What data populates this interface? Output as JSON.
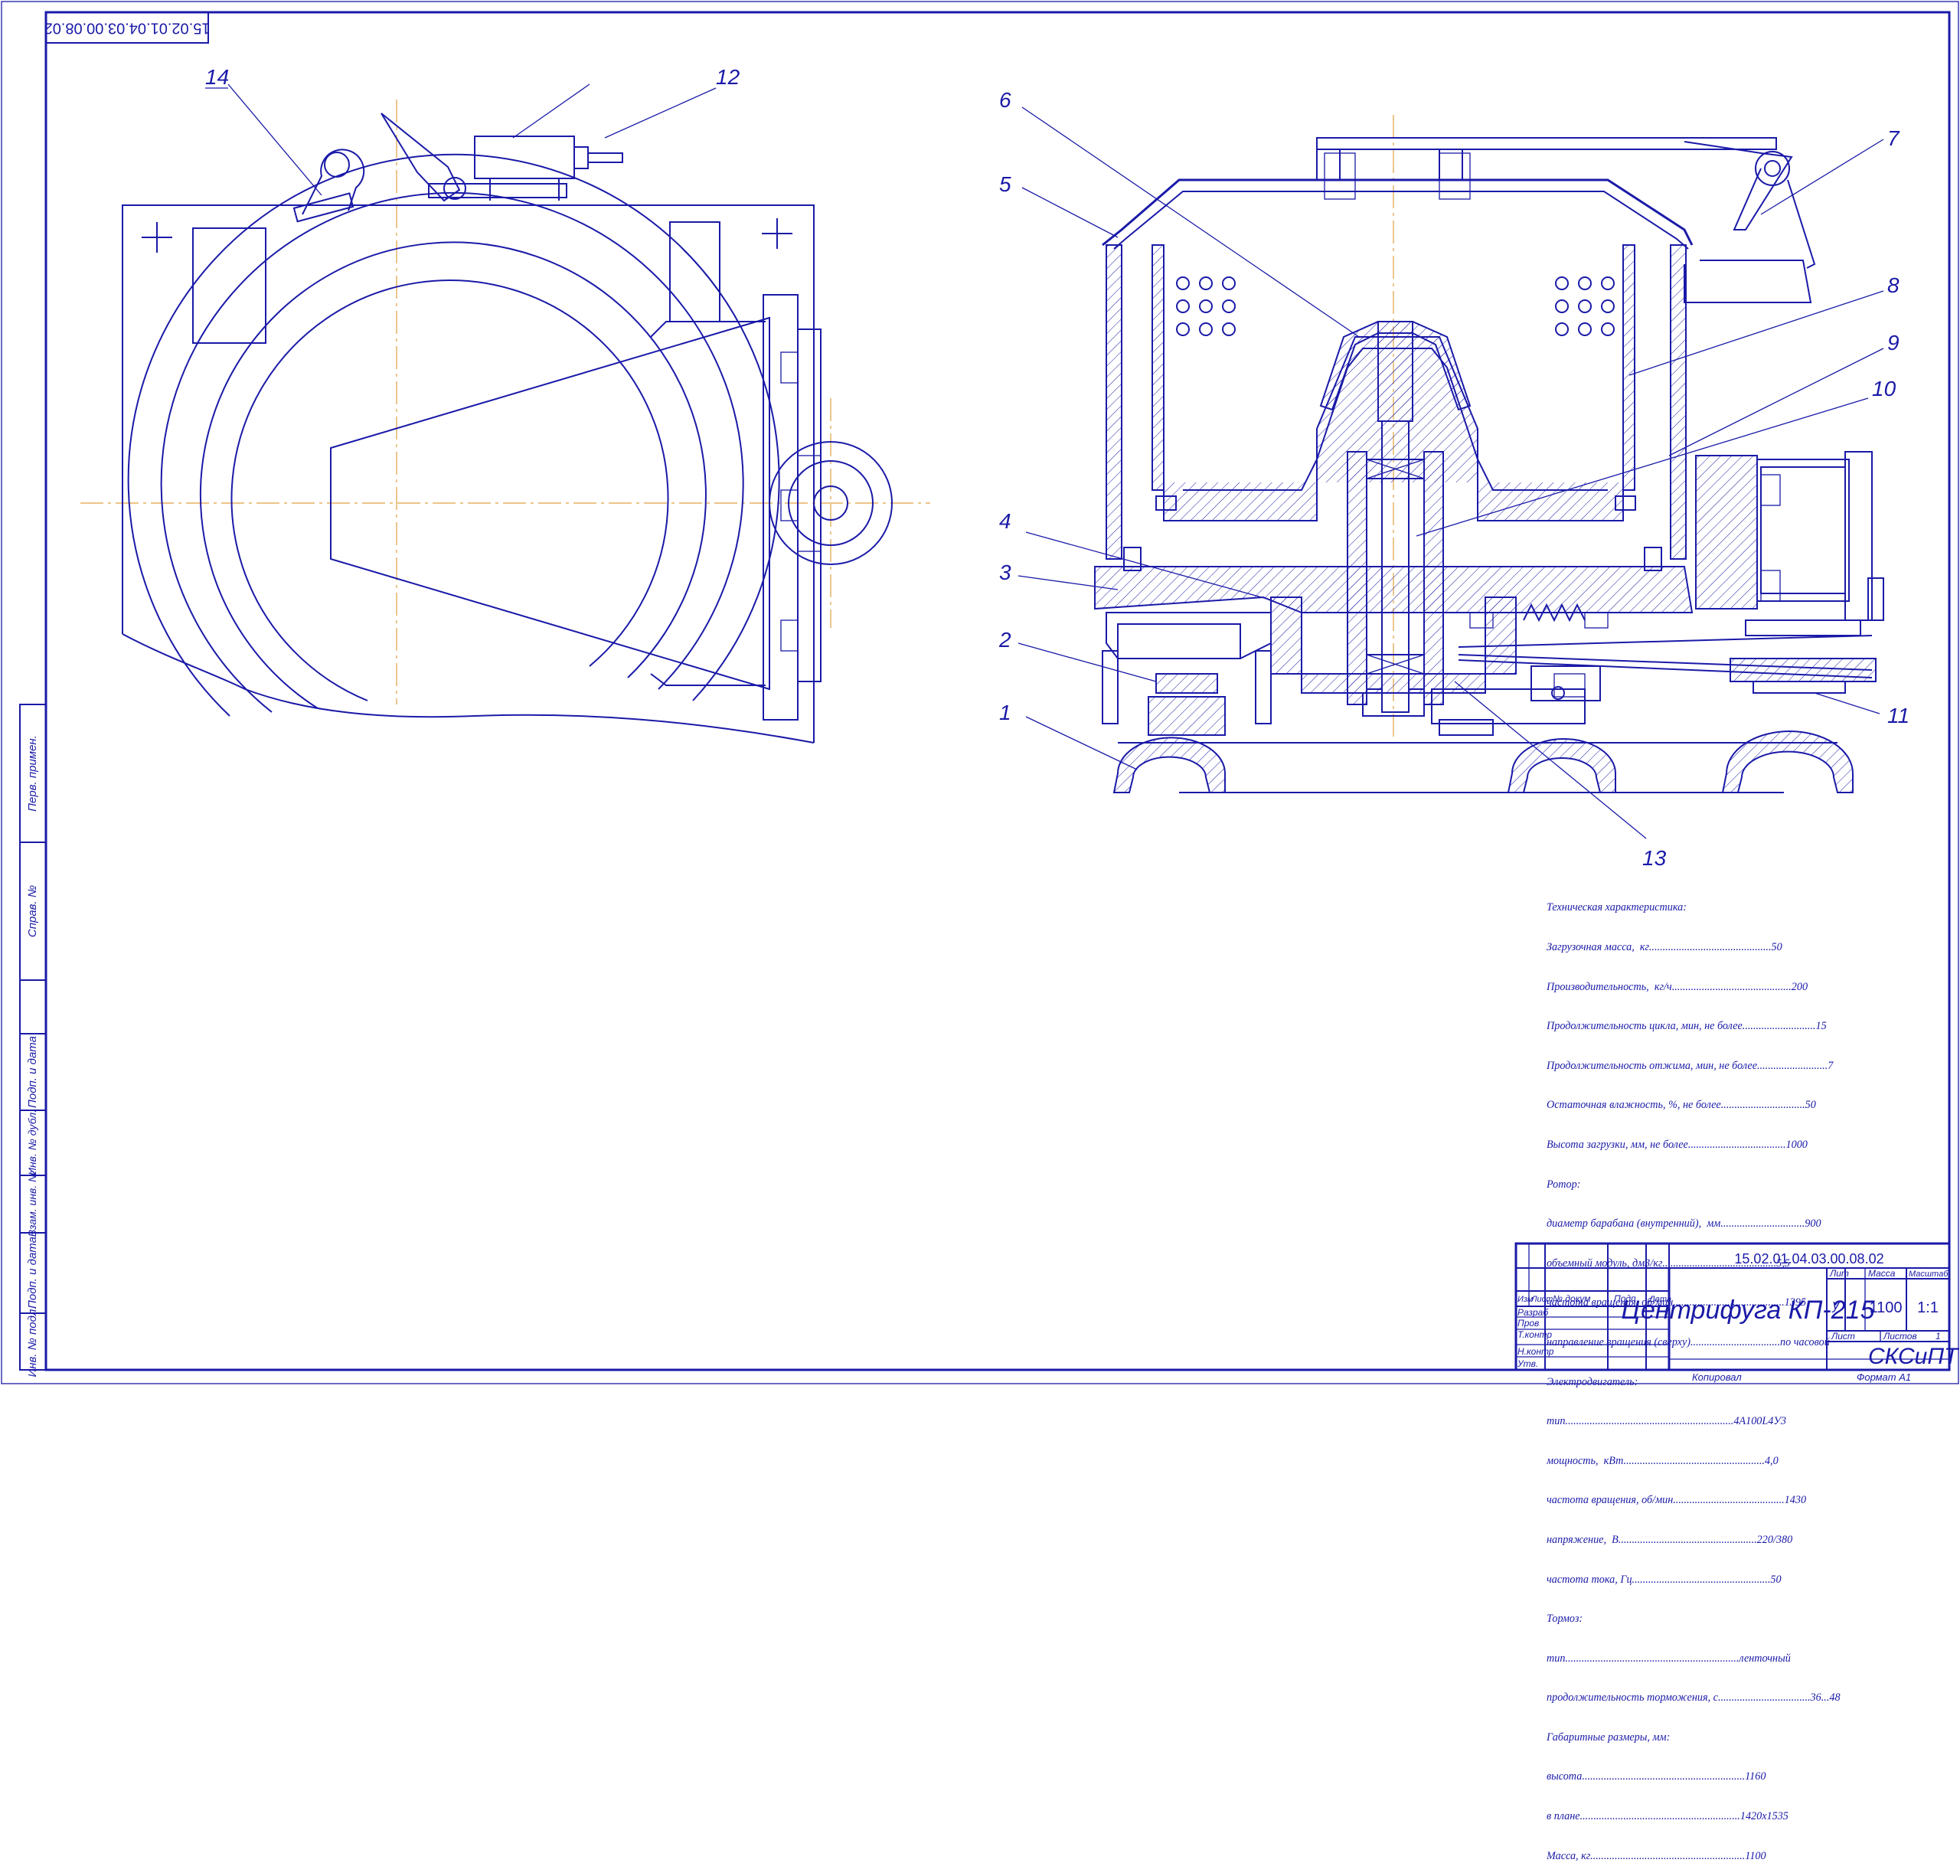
{
  "stamp_code_rotated": "15.02.01.04.03.00.08.02",
  "callouts": [
    "1",
    "2",
    "3",
    "4",
    "5",
    "6",
    "7",
    "8",
    "9",
    "10",
    "11",
    "12",
    "13",
    "14"
  ],
  "spec": {
    "title": "Техническая характеристика:",
    "lines": [
      "Загрузочная масса,  кг.............................................50",
      "Производительность,  кг/ч............................................200",
      "Продолжительность цикла, мин, не более...........................15",
      "Продолжительность отжима, мин, не более..........................7",
      "Остаточная влажность, %, не более...............................50",
      "Высота загрузки, мм, не более....................................1000",
      "Ротор:",
      "диаметр барабана (внутренний),  мм...............................900",
      "объемный модуль, дм3/кг..........................................5,5",
      "частота вращения, об/мин.........................................1395",
      "направление вращения (сверху).................................по часовой",
      "Электродвигатель:",
      "тип..............................................................4А100L4У3",
      "мощность,  кВт....................................................4,0",
      "частота вращения, об/мин.........................................1430",
      "напряжение,  В...................................................220/380",
      "частота тока, Гц...................................................50",
      "Тормоз:",
      "тип................................................................ленточный",
      "продолжительность торможения, с..................................36...48",
      "Габаритные размеры, мм:",
      "высота............................................................1160",
      "в плане...........................................................1420х1535",
      "Масса, кг.........................................................1100"
    ]
  },
  "title_block": {
    "code": "15.02.01.04.03.00.08.02",
    "name": "Центрифуга КП-215",
    "col_izm": "Изм",
    "col_list": "Лист",
    "col_doc": "№ докум",
    "col_sign": "Подп",
    "col_date": "Дата",
    "row_razrab": "Разраб",
    "row_prov": "Пров",
    "row_tkontr": "Т.контр",
    "row_nkontr": "Н.контр",
    "row_utv": "Утв.",
    "lit_label": "Лит",
    "mass_label": "Масса",
    "scale_label": "Масштаб",
    "lit_value": "у",
    "mass_value": "1100",
    "scale_value": "1:1",
    "sheet_label": "Лист",
    "sheets_label": "Листов",
    "sheets_value": "1",
    "org": "СКСиПТ",
    "copied": "Копировал",
    "format": "Формат  А1"
  },
  "left_strip": [
    "Перв. примен.",
    "Справ. №",
    "Подп. и дата",
    "Инв. № дубл.",
    "Взам. инв. №",
    "Подп. и дата",
    "Инв. № подл."
  ]
}
